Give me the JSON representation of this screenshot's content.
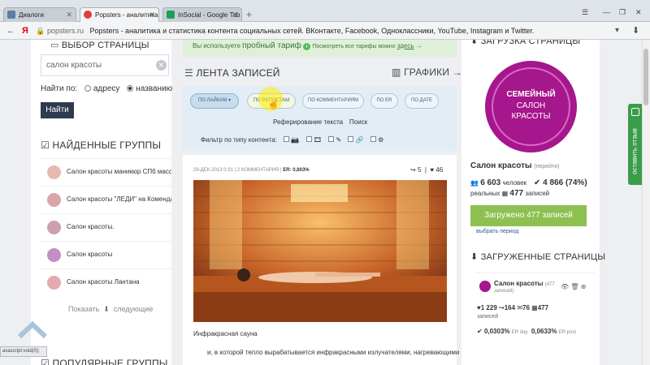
{
  "browser": {
    "tabs": [
      {
        "label": "Диалоги"
      },
      {
        "label": "Popsters - аналитика"
      },
      {
        "label": "InSocial - Google Tab"
      }
    ],
    "url_domain": "popsters.ru",
    "url_title": "Popsters - аналитика и статистика контента социальных сетей. ВКонтакте, Facebook, Одноклассники, YouTube, Instagram и Twitter.",
    "yandex_glyph": "Я"
  },
  "left": {
    "section_select": "ВЫБОР СТРАНИЦЫ",
    "search_value": "салон красоты",
    "find_by": "Найти по:",
    "opt_address": "адресу",
    "opt_name": "названию",
    "find_button": "Найти",
    "found_groups_title": "НАЙДЕННЫЕ ГРУППЫ",
    "groups": [
      {
        "name": "Салон красоты маникюр СПб массаж стр"
      },
      {
        "name": "Салон красоты \"ЛЕДИ\" на Комендантском"
      },
      {
        "name": "Салон красоты."
      },
      {
        "name": "Салон красоты"
      },
      {
        "name": "Салон красоты Лантана"
      }
    ],
    "show_label": "Показать",
    "next_label": "следующие",
    "popular_title": "ПОПУЛЯРНЫЕ ГРУППЫ"
  },
  "middle": {
    "promo_prefix": "Вы используете",
    "promo_plan": "пробный тариф",
    "promo_link_prefix": "Посмотреть все тарифы можно",
    "promo_link": "здесь",
    "feed_title": "ЛЕНТА ЗАПИСЕЙ",
    "charts_title": "ГРАФИКИ",
    "sort_buttons": [
      "ПО ЛАЙКАМ",
      "ПО РЕПОСТАМ",
      "ПО КОММЕНТАРИЯМ",
      "ПО ER",
      "ПО ДАТЕ"
    ],
    "ref_text": "Реферирование текста",
    "search": "Поиск",
    "filter_label": "Фильтр по типу контента:",
    "post": {
      "date": "29-ДЕК-2013 0:31",
      "comments": "2 КОММЕНТАРИЯ",
      "er": "ER: 0,803%",
      "reposts": "5",
      "likes": "46",
      "caption": "Инфракрасная сауна",
      "text": "и, в которой тепло вырабатывается инфракрасными излучателями, нагревающими"
    }
  },
  "right": {
    "load_title": "ЗАГРУЗКА СТРАНИЦЫ",
    "logo_line1": "СЕМЕЙНЫЙ",
    "logo_line2": "САЛОН",
    "logo_line3": "КРАСОТЫ",
    "page_name": "Салон красоты",
    "page_name_note": "(перейти)",
    "members": "6 603",
    "members_label": "человек",
    "active": "4 866 (74%)",
    "active_label": "реальных",
    "posts": "477",
    "posts_label": "записей",
    "loaded_button": "Загружено 477 записей",
    "choose_period": "выбрать период",
    "loaded_pages_title": "ЗАГРУЖЕННЫЕ СТРАНИЦЫ",
    "lp_name": "Салон красоты",
    "lp_count": "(477",
    "lp_count2": "записей)",
    "lp_likes": "1 229",
    "lp_reposts": "164",
    "lp_comments": "76",
    "lp_posts": "477",
    "lp_posts_label": "записей",
    "lp_er_day": "0,0303%",
    "lp_er_day_label": "ER day",
    "lp_er_post": "0,0633%",
    "lp_er_post_label": "ER post"
  },
  "feedback_label": "оставить отзыв",
  "status_text": "avascript:void(0);",
  "colors": {
    "accent": "#2e3b4e",
    "green": "#8cc152",
    "logo": "#a6168c",
    "blue": "#3f5f80"
  }
}
